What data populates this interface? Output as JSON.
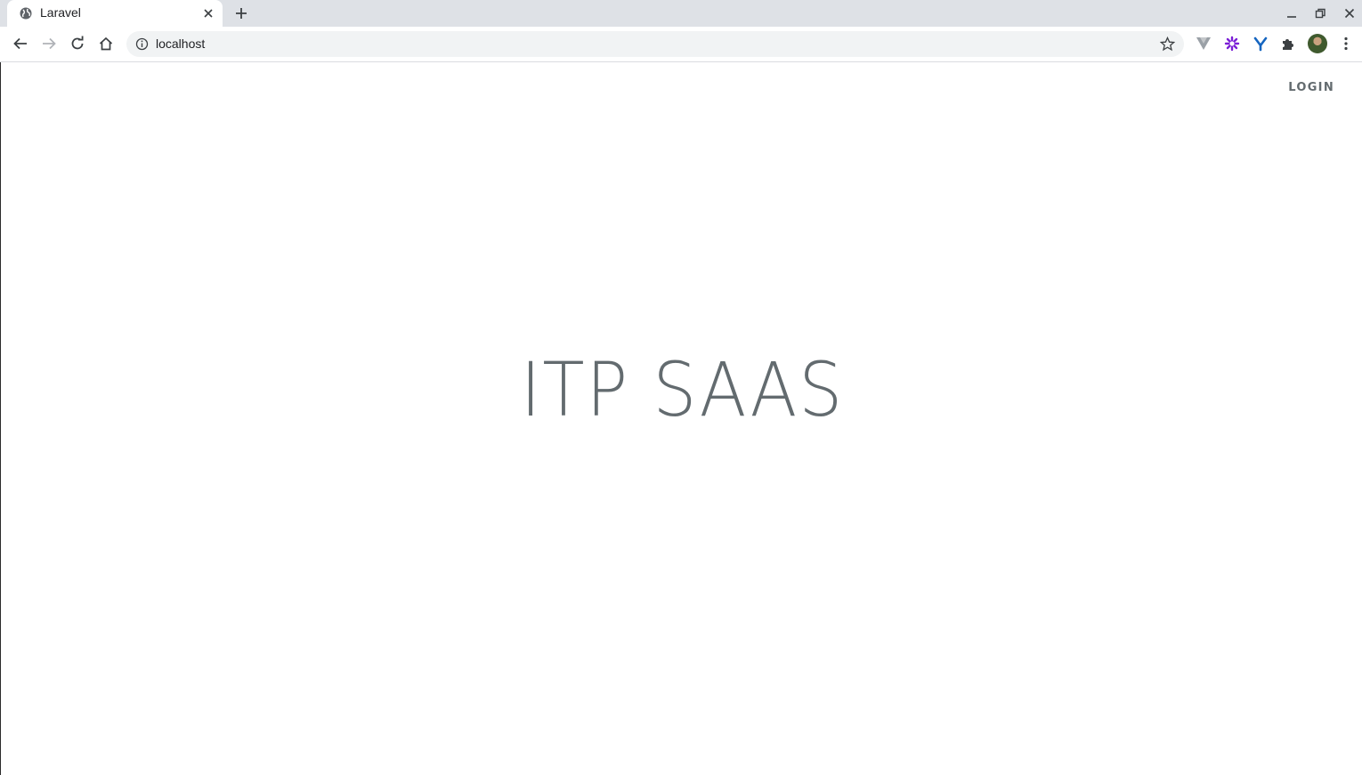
{
  "browser": {
    "tab": {
      "title": "Laravel",
      "favicon": "globe-icon"
    },
    "new_tab_icon": "plus-icon",
    "window_controls": [
      "minimize-icon",
      "restore-icon",
      "close-icon"
    ],
    "toolbar": {
      "nav_icons": [
        "back-arrow-icon",
        "forward-arrow-icon",
        "reload-icon",
        "home-icon"
      ],
      "omnibox": {
        "url": "localhost",
        "site_info_icon": "info-icon",
        "bookmark_icon": "star-icon"
      },
      "extensions": [
        "vuejs-devtools-icon",
        "purple-flower-extension-icon",
        "yoast-extension-icon",
        "puzzle-extensions-icon"
      ],
      "menu_icon": "kebab-menu-icon"
    }
  },
  "page": {
    "nav": {
      "login_label": "Login"
    },
    "title": "ITP SAAS"
  },
  "colors": {
    "text": "#636b6f",
    "tabstrip": "#dee1e6",
    "omnibox": "#f1f3f4"
  }
}
